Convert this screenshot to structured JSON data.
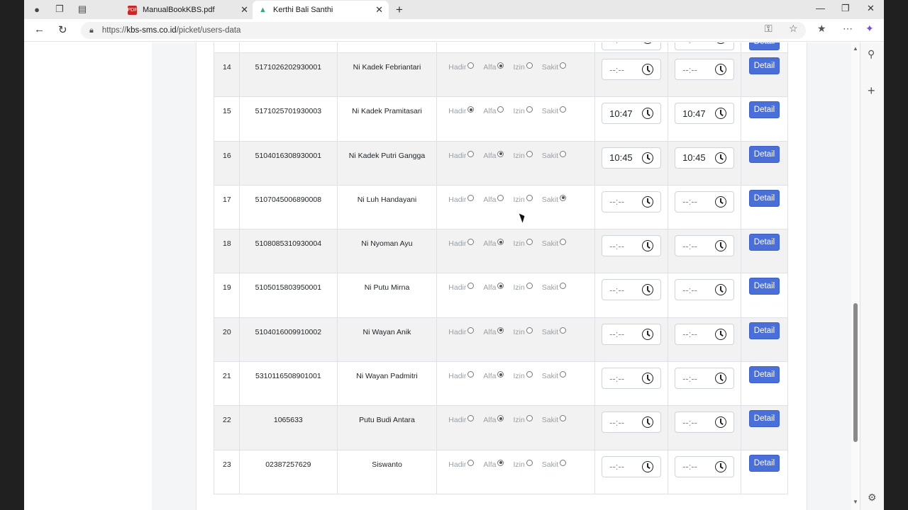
{
  "browser": {
    "tabs": [
      {
        "title": "ManualBookKBS.pdf",
        "icon": "pdf-icon",
        "active": false
      },
      {
        "title": "Kerthi Bali Santhi",
        "icon": "site-logo-icon",
        "active": true
      }
    ],
    "url_prefix": "https://",
    "url_host": "kbs-sms.co.id",
    "url_path": "/picket/users-data"
  },
  "table": {
    "status_labels": {
      "hadir": "Hadir",
      "alfa": "Alfa",
      "izin": "Izin",
      "sakit": "Sakit"
    },
    "detail_label": "Detail",
    "empty_time": "--:--",
    "rows": [
      {
        "no": "14",
        "nik": "5171026202930001",
        "name": "Ni Kadek Febriantari",
        "status": "alfa",
        "time_in": "",
        "time_out": ""
      },
      {
        "no": "15",
        "nik": "5171025701930003",
        "name": "Ni Kadek Pramitasari",
        "status": "hadir",
        "time_in": "10:47",
        "time_out": "10:47"
      },
      {
        "no": "16",
        "nik": "5104016308930001",
        "name": "Ni Kadek Putri Gangga",
        "status": "alfa",
        "time_in": "10:45",
        "time_out": "10:45"
      },
      {
        "no": "17",
        "nik": "5107045006890008",
        "name": "Ni Luh Handayani",
        "status": "sakit",
        "time_in": "",
        "time_out": ""
      },
      {
        "no": "18",
        "nik": "5108085310930004",
        "name": "Ni Nyoman Ayu",
        "status": "alfa",
        "time_in": "",
        "time_out": ""
      },
      {
        "no": "19",
        "nik": "5105015803950001",
        "name": "Ni Putu Mirna",
        "status": "alfa",
        "time_in": "",
        "time_out": ""
      },
      {
        "no": "20",
        "nik": "5104016009910002",
        "name": "Ni Wayan Anik",
        "status": "alfa",
        "time_in": "",
        "time_out": ""
      },
      {
        "no": "21",
        "nik": "5310116508901001",
        "name": "Ni Wayan Padmitri",
        "status": "alfa",
        "time_in": "",
        "time_out": ""
      },
      {
        "no": "22",
        "nik": "1065633",
        "name": "Putu Budi Antara",
        "status": "alfa",
        "time_in": "",
        "time_out": ""
      },
      {
        "no": "23",
        "nik": "02387257629",
        "name": "Siswanto",
        "status": "alfa",
        "time_in": "",
        "time_out": ""
      }
    ]
  },
  "colors": {
    "accent": "#4a6fd8",
    "row_stripe": "#f2f2f2"
  }
}
